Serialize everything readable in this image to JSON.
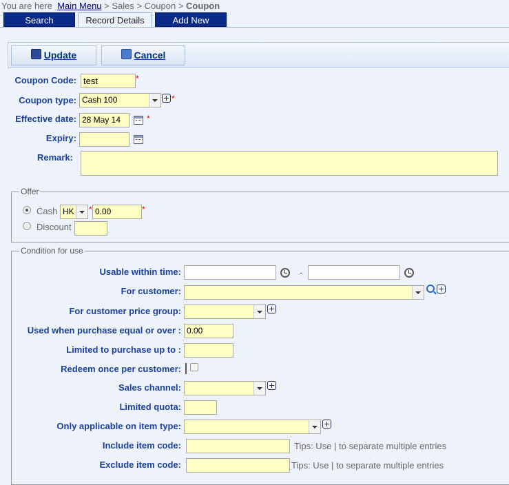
{
  "breadcrumb": {
    "prefix": "You are here",
    "main_menu": "Main Menu",
    "sep1": " > Sales > Coupon > ",
    "current": "Coupon"
  },
  "tabs": {
    "search": "Search",
    "record_details": "Record Details",
    "add_new": "Add New"
  },
  "toolbar": {
    "update": "Update",
    "cancel": "Cancel"
  },
  "form": {
    "coupon_code_label": "Coupon Code:",
    "coupon_code_value": "test",
    "coupon_type_label": "Coupon type:",
    "coupon_type_value": "Cash 100",
    "effective_date_label": "Effective date:",
    "effective_date_value": "28 May 14",
    "expiry_label": "Expiry:",
    "expiry_value": "",
    "remark_label": "Remark:",
    "remark_value": "",
    "required_mark": "*"
  },
  "offer": {
    "legend": "Offer",
    "cash_label": "Cash",
    "currency_value": "HK",
    "cash_value": "0.00",
    "discount_label": "Discount",
    "discount_value": "",
    "selected": "cash"
  },
  "condition": {
    "legend": "Condition for use",
    "usable_label": "Usable within time:",
    "time_sep": "-",
    "customer_label": "For customer:",
    "price_group_label": "For customer price group:",
    "purchase_over_label": "Used when purchase equal or over :",
    "purchase_over_value": "0.00",
    "purchase_limit_label": "Limited to purchase up to :",
    "redeem_once_label": "Redeem once per customer:",
    "sales_channel_label": "Sales channel:",
    "quota_label": "Limited quota:",
    "item_type_label": "Only applicable on item type:",
    "include_label": "Include item code:",
    "exclude_label": "Exclude item code:",
    "tip": "Tips: Use | to separate multiple entries"
  }
}
